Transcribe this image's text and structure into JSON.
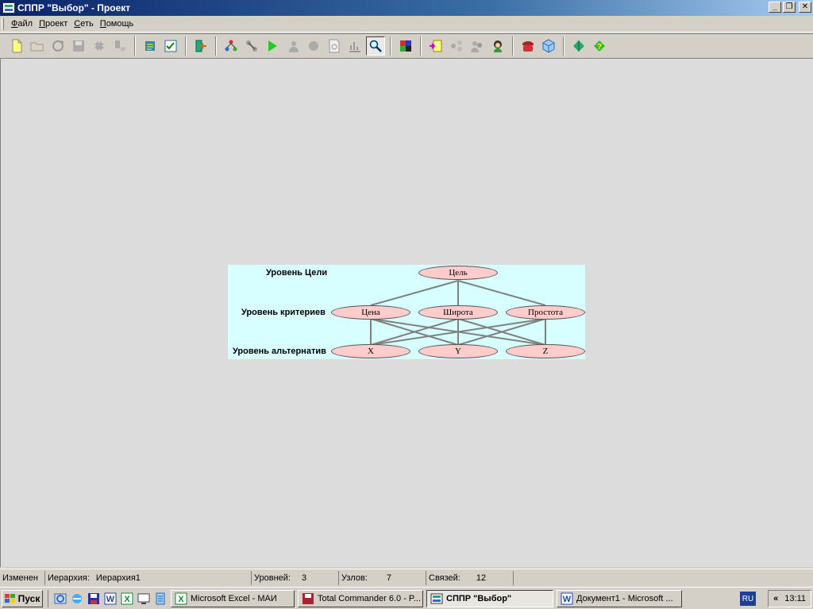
{
  "window": {
    "title": "СППР \"Выбор\" - Проект",
    "controls": {
      "minimize": "_",
      "restore": "❐",
      "close": "✕"
    }
  },
  "menu": {
    "items": [
      {
        "first": "Ф",
        "rest": "айл"
      },
      {
        "first": "П",
        "rest": "роект"
      },
      {
        "first": "С",
        "rest": "еть"
      },
      {
        "first": "П",
        "rest": "омощь"
      }
    ]
  },
  "diagram": {
    "levels": [
      "Уровень Цели",
      "Уровень критериев",
      "Уровень альтернатив"
    ],
    "goal": "Цель",
    "criteria": [
      "Цена",
      "Широта",
      "Простота"
    ],
    "alternatives": [
      "X",
      "Y",
      "Z"
    ],
    "colors": {
      "background": "#d8ffff",
      "node_fill": "#ffcccc",
      "edge": "#808080"
    }
  },
  "status": {
    "state": "Изменен",
    "hierarchy_label": "Иерархия:",
    "hierarchy_value": "Иерархия1",
    "levels_label": "Уровней:",
    "levels_value": "3",
    "nodes_label": "Узлов:",
    "nodes_value": "7",
    "links_label": "Связей:",
    "links_value": "12"
  },
  "taskbar": {
    "start": "Пуск",
    "tasks": [
      "Microsoft Excel - МАИ",
      "Total Commander 6.0 - P...",
      "СППР \"Выбор\"",
      "Документ1 - Microsoft ..."
    ],
    "lang": "RU",
    "expand": "«",
    "clock": "13:11"
  }
}
